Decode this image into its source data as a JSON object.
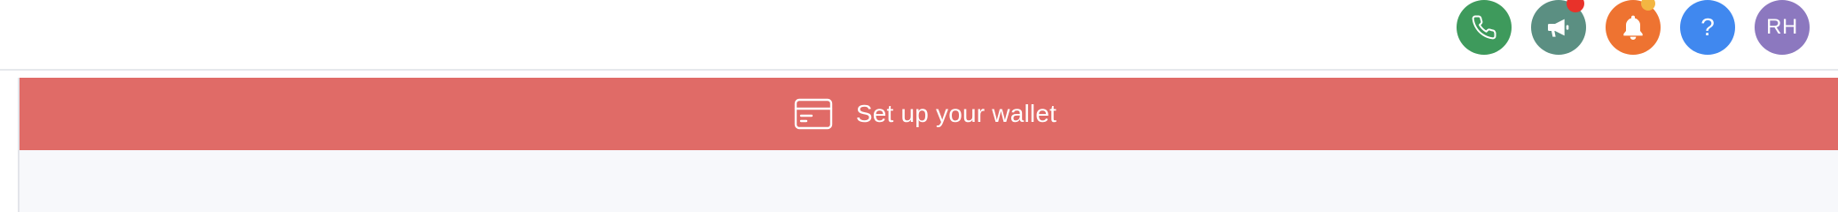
{
  "header": {
    "actions": [
      {
        "name": "phone",
        "icon": "phone-icon",
        "color": "#3e9a5c"
      },
      {
        "name": "announcements",
        "icon": "megaphone-icon",
        "color": "#5b8f82",
        "badge_color": "#e8322a"
      },
      {
        "name": "notifications",
        "icon": "bell-icon",
        "color": "#ee7331",
        "badge_color": "#f3b642"
      },
      {
        "name": "help",
        "icon": "question-icon",
        "label": "?",
        "color": "#4088ef"
      }
    ],
    "avatar": {
      "initials": "RH",
      "color": "#8c78bf"
    }
  },
  "banner": {
    "text": "Set up your wallet",
    "icon": "credit-card-icon",
    "color": "#e06b67"
  },
  "main": {
    "background": "#f7f8fb"
  }
}
